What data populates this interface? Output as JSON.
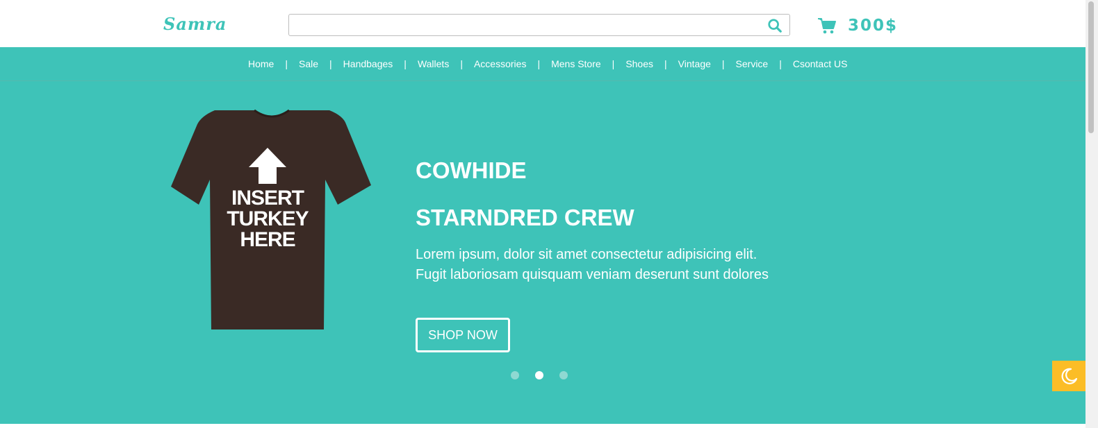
{
  "header": {
    "logo": "Samra",
    "search": {
      "value": "",
      "placeholder": ""
    },
    "cart_total": "300$"
  },
  "nav": {
    "items": [
      "Home",
      "Sale",
      "Handbages",
      "Wallets",
      "Accessories",
      "Mens Store",
      "Shoes",
      "Vintage",
      "Service",
      "Csontact US"
    ],
    "separator": "|"
  },
  "hero": {
    "shirt_print": [
      "INSERT",
      "TURKEY",
      "HERE"
    ],
    "title_line1": "COWHIDE",
    "title_line2": "STARNDRED CREW",
    "description": "Lorem ipsum, dolor sit amet consectetur adipisicing elit. Fugit laboriosam quisquam veniam deserunt sunt dolores",
    "button_label": "SHOP NOW",
    "slides": {
      "count": 3,
      "active_index": 1
    }
  },
  "icons": {
    "search": "search-icon",
    "cart": "cart-icon",
    "theme": "moon-icon"
  },
  "colors": {
    "accent": "#3ec3b8",
    "toggle": "#fbbd27",
    "shirt": "#3a2a25"
  }
}
